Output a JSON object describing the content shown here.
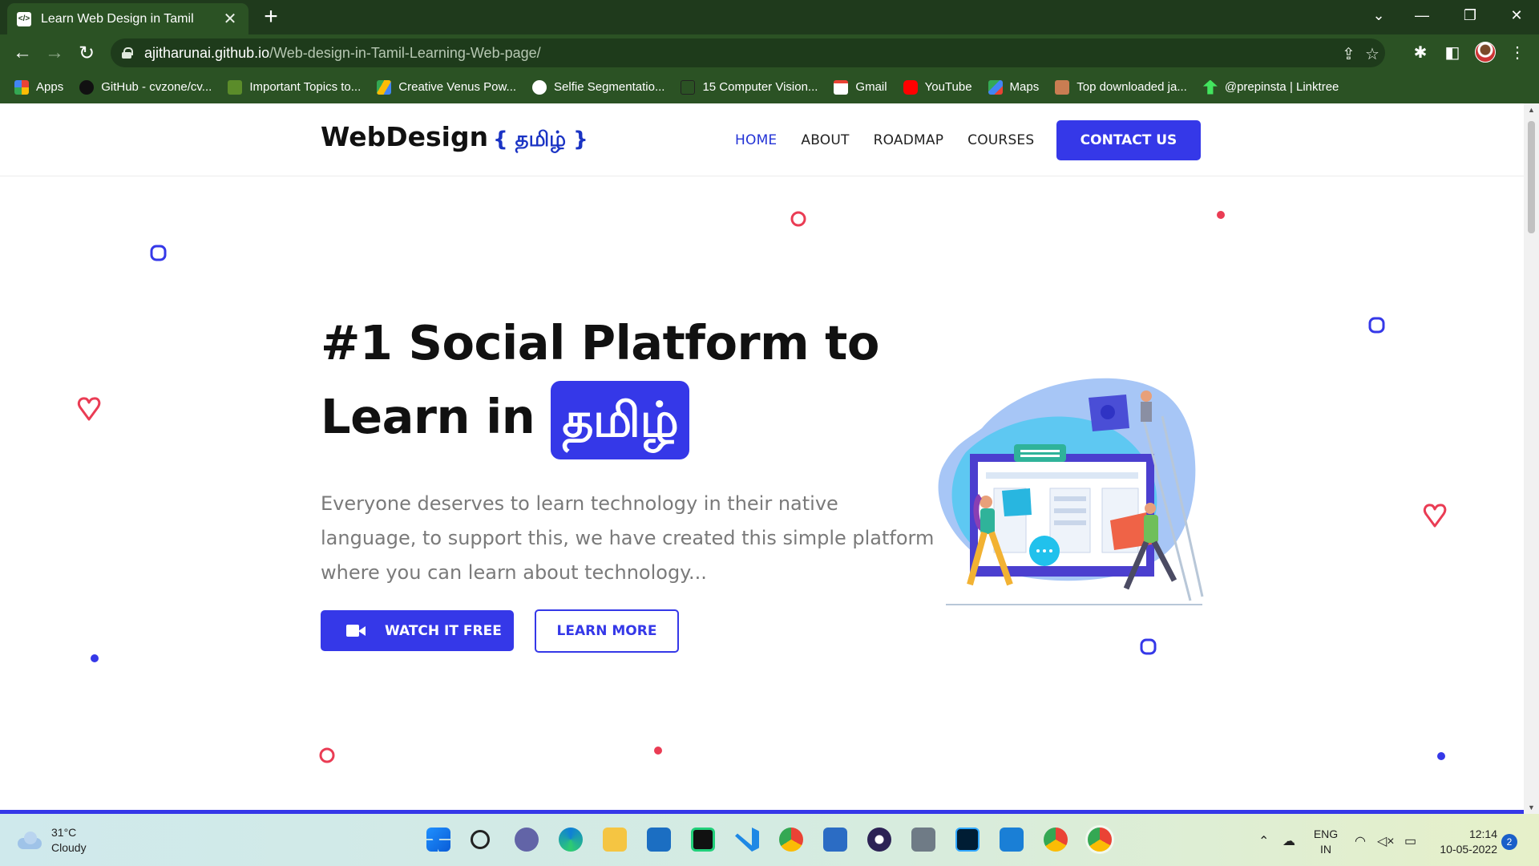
{
  "browser": {
    "tab_title": "Learn Web Design in Tamil",
    "url_host": "ajitharunai.github.io",
    "url_path": "/Web-design-in-Tamil-Learning-Web-page/",
    "bookmarks": [
      {
        "label": "Apps",
        "icon": "apps-grid-icon",
        "color": "#e74c3c"
      },
      {
        "label": "GitHub - cvzone/cv...",
        "icon": "github-icon",
        "color": "#111111"
      },
      {
        "label": "Important Topics to...",
        "icon": "avatar-icon",
        "color": "#5b8c2a"
      },
      {
        "label": "Creative Venus Pow...",
        "icon": "drive-icon",
        "color": "#f4b400"
      },
      {
        "label": "Selfie Segmentatio...",
        "icon": "globe-icon",
        "color": "#ffffff"
      },
      {
        "label": "15 Computer Vision...",
        "icon": "medium-icon",
        "color": "#333333"
      },
      {
        "label": "Gmail",
        "icon": "gmail-icon",
        "color": "#ea4335"
      },
      {
        "label": "YouTube",
        "icon": "youtube-icon",
        "color": "#ff0000"
      },
      {
        "label": "Maps",
        "icon": "maps-icon",
        "color": "#34a853"
      },
      {
        "label": "Top downloaded ja...",
        "icon": "bookmark-site-icon",
        "color": "#c97d52"
      },
      {
        "label": "@prepinsta | Linktree",
        "icon": "linktree-icon",
        "color": "#43e55e"
      }
    ]
  },
  "site": {
    "logo": "WebDesign",
    "logo_tamil": "{ தமிழ் }",
    "nav": [
      "HOME",
      "ABOUT",
      "ROADMAP",
      "COURSES"
    ],
    "contact": "CONTACT US",
    "hero_line1": "#1 Social Platform to",
    "hero_line2": "Learn in",
    "hero_badge": "தமிழ்",
    "description": "Everyone deserves to learn technology in their native language, to support this, we have created this simple platform where you can learn about technology...",
    "watch_button": "WATCH IT FREE",
    "learn_button": "LEARN MORE",
    "accent_color": "#3538e8"
  },
  "taskbar": {
    "temperature": "31°C",
    "condition": "Cloudy",
    "language": "ENG",
    "region": "IN",
    "time": "12:14",
    "date": "10-05-2022",
    "notifications": "2"
  }
}
